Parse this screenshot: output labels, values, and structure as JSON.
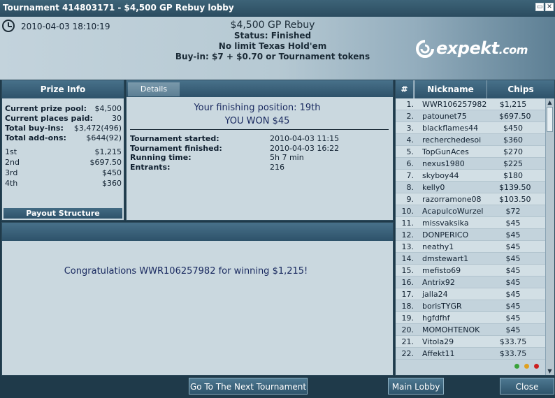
{
  "window": {
    "title": "Tournament 414803171 - $4,500 GP Rebuy lobby",
    "minimize_glyph": "▭",
    "close_glyph": "✕"
  },
  "header": {
    "datetime": "2010-04-03 18:10:19",
    "title": "$4,500 GP Rebuy",
    "status": "Status: Finished",
    "game": "No limit Texas Hold'em",
    "buyin": "Buy-in: $7 + $0.70 or Tournament tokens",
    "logo_text": "expekt",
    "logo_suffix": ".com"
  },
  "prize_info": {
    "title": "Prize Info",
    "rows": [
      {
        "label": "Current prize pool:",
        "value": "$4,500"
      },
      {
        "label": "Current places paid:",
        "value": "30"
      },
      {
        "label": "Total buy-ins:",
        "value": "$3,472(496)"
      },
      {
        "label": "Total add-ons:",
        "value": "$644(92)"
      }
    ],
    "places": [
      {
        "label": "1st",
        "value": "$1,215"
      },
      {
        "label": "2nd",
        "value": "$697.50"
      },
      {
        "label": "3rd",
        "value": "$450"
      },
      {
        "label": "4th",
        "value": "$360"
      }
    ],
    "payout_button": "Payout Structure"
  },
  "details": {
    "tab_label": "Details",
    "finishing_position": "Your finishing position:  19th",
    "won": "YOU WON $45",
    "rows": [
      {
        "label": "Tournament started:",
        "value": "2010-04-03 11:15"
      },
      {
        "label": "Tournament finished:",
        "value": "2010-04-03 16:22"
      },
      {
        "label": "Running time:",
        "value": "5h 7 min"
      },
      {
        "label": "Entrants:",
        "value": "216"
      }
    ]
  },
  "message": {
    "text": "Congratulations WWR106257982 for winning $1,215!"
  },
  "players": {
    "headers": {
      "rank": "#",
      "nickname": "Nickname",
      "chips": "Chips"
    },
    "rows": [
      {
        "rank": "1.",
        "nickname": "WWR106257982",
        "chips": "$1,215"
      },
      {
        "rank": "2.",
        "nickname": "patounet75",
        "chips": "$697.50"
      },
      {
        "rank": "3.",
        "nickname": "blackflames44",
        "chips": "$450"
      },
      {
        "rank": "4.",
        "nickname": "recherchedesoi",
        "chips": "$360"
      },
      {
        "rank": "5.",
        "nickname": "TopGunAces",
        "chips": "$270"
      },
      {
        "rank": "6.",
        "nickname": "nexus1980",
        "chips": "$225"
      },
      {
        "rank": "7.",
        "nickname": "skyboy44",
        "chips": "$180"
      },
      {
        "rank": "8.",
        "nickname": "kelly0",
        "chips": "$139.50"
      },
      {
        "rank": "9.",
        "nickname": "razorramone08",
        "chips": "$103.50"
      },
      {
        "rank": "10.",
        "nickname": "AcapulcoWurzel",
        "chips": "$72"
      },
      {
        "rank": "11.",
        "nickname": "missvaksika",
        "chips": "$45"
      },
      {
        "rank": "12.",
        "nickname": "DONPERICO",
        "chips": "$45"
      },
      {
        "rank": "13.",
        "nickname": "neathy1",
        "chips": "$45"
      },
      {
        "rank": "14.",
        "nickname": "dmstewart1",
        "chips": "$45"
      },
      {
        "rank": "15.",
        "nickname": "mefisto69",
        "chips": "$45"
      },
      {
        "rank": "16.",
        "nickname": "Antrix92",
        "chips": "$45"
      },
      {
        "rank": "17.",
        "nickname": "jalla24",
        "chips": "$45"
      },
      {
        "rank": "18.",
        "nickname": "borisTYGR",
        "chips": "$45"
      },
      {
        "rank": "19.",
        "nickname": "hgfdfhf",
        "chips": "$45"
      },
      {
        "rank": "20.",
        "nickname": "MOMOHTENOK",
        "chips": "$45"
      },
      {
        "rank": "21.",
        "nickname": "Vitola29",
        "chips": "$33.75"
      },
      {
        "rank": "22.",
        "nickname": "Affekt11",
        "chips": "$33.75"
      }
    ],
    "scroll_up_glyph": "▲",
    "scroll_down_glyph": "▼",
    "status_dots": [
      "#3aa23a",
      "#e0a020",
      "#cc2020"
    ]
  },
  "footer": {
    "next_tournament": "Go To The Next Tournament",
    "main_lobby": "Main Lobby",
    "close": "Close"
  }
}
